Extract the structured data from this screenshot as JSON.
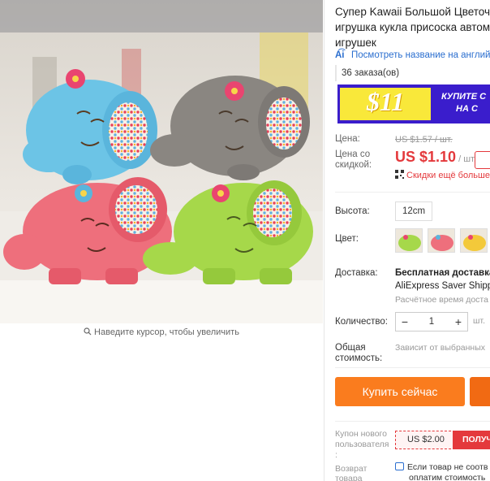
{
  "gallery": {
    "zoom_hint": "Наведите курсор, чтобы увеличить",
    "image_alt_icon": "stuffed-elephants-photo"
  },
  "product": {
    "title_line1": "Супер Kawaii Большой Цветочи",
    "title_line2": "игрушка кукла присоска автом",
    "title_line3": "игрушек",
    "translate_link": "Посмотреть название на англий",
    "orders": "36 заказа(ов)"
  },
  "banner": {
    "amount": "$11",
    "text_line1": "КУПИТЕ С",
    "text_line2": "НА С",
    "bg_color": "#3a1dcc",
    "accent_color": "#f9e83a"
  },
  "price": {
    "label": "Цена:",
    "old": "US $1.57 / шт.",
    "discount_label_line1": "Цена со",
    "discount_label_line2": "скидкой:",
    "new": "US $1.10",
    "unit": " / шт.",
    "more_discounts": "Скидки ещё больше",
    "accent_color": "#e4393c"
  },
  "options": {
    "height_label": "Высота:",
    "height_value": "12cm",
    "color_label": "Цвет:",
    "swatches": [
      "green-elephant",
      "pink-elephant",
      "yellow-elephant"
    ]
  },
  "shipping": {
    "label": "Доставка:",
    "title_line1": "Бесплатная доставка",
    "title_line2": "AliExpress Saver Shipp",
    "subtitle": "Расчётное время доста"
  },
  "quantity": {
    "label": "Количество:",
    "minus": "−",
    "value": "1",
    "plus": "+",
    "unit": "шт."
  },
  "total": {
    "label_line1": "Общая",
    "label_line2": "стоимость:",
    "value": "Зависит от выбранных"
  },
  "actions": {
    "buy_now": "Купить сейчас",
    "buy_color": "#fa7c1e"
  },
  "coupon": {
    "label_line1": "Купон нового",
    "label_line2": "пользователя",
    "label_line3": ":",
    "amount": "US $2.00",
    "get": "ПОЛУЧ"
  },
  "returns": {
    "label_line1": "Возврат",
    "label_line2": "товара",
    "text_line1": "Если товар не соотв",
    "text_line2": "оплатим стоимость"
  }
}
